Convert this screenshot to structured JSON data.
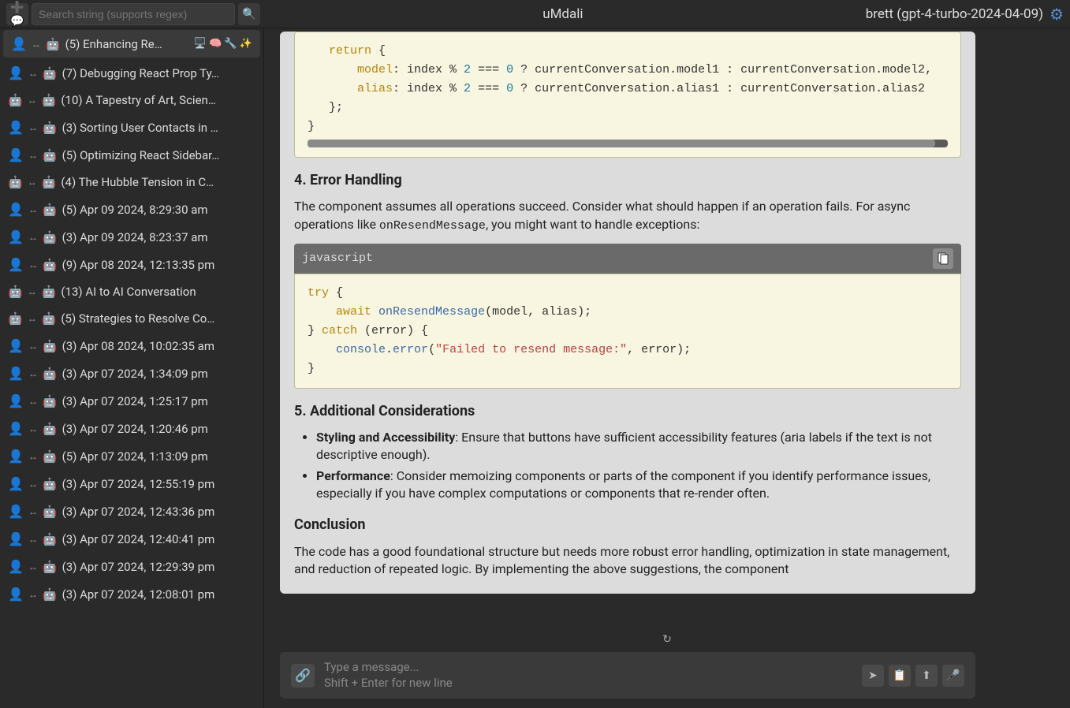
{
  "header": {
    "app_title": "uMdali",
    "user_model": "brett (gpt-4-turbo-2024-04-09)",
    "search_placeholder": "Search string (supports regex)"
  },
  "sidebar": {
    "items": [
      {
        "left_icon": "user",
        "count": 5,
        "title": "Enhancing Re…",
        "extra": "🖥️ 🧠 🔧 ✨",
        "active": true
      },
      {
        "left_icon": "user",
        "count": 7,
        "title": "Debugging React Prop Ty…"
      },
      {
        "left_icon": "robot",
        "count": 10,
        "title": "A Tapestry of Art, Scien…"
      },
      {
        "left_icon": "user",
        "count": 3,
        "title": "Sorting User Contacts in …"
      },
      {
        "left_icon": "user",
        "count": 5,
        "title": "Optimizing React Sidebar…"
      },
      {
        "left_icon": "robot",
        "count": 4,
        "title": "The Hubble Tension in C…"
      },
      {
        "left_icon": "user",
        "count": 5,
        "title": "Apr 09 2024, 8:29:30 am"
      },
      {
        "left_icon": "user",
        "count": 3,
        "title": "Apr 09 2024, 8:23:37 am"
      },
      {
        "left_icon": "user",
        "count": 9,
        "title": "Apr 08 2024, 12:13:35 pm"
      },
      {
        "left_icon": "robot",
        "count": 13,
        "title": "AI to AI Conversation"
      },
      {
        "left_icon": "robot",
        "count": 5,
        "title": "Strategies to Resolve Co…"
      },
      {
        "left_icon": "user",
        "count": 3,
        "title": "Apr 08 2024, 10:02:35 am"
      },
      {
        "left_icon": "user",
        "count": 3,
        "title": "Apr 07 2024, 1:34:09 pm"
      },
      {
        "left_icon": "user",
        "count": 3,
        "title": "Apr 07 2024, 1:25:17 pm"
      },
      {
        "left_icon": "user",
        "count": 3,
        "title": "Apr 07 2024, 1:20:46 pm"
      },
      {
        "left_icon": "user",
        "count": 5,
        "title": "Apr 07 2024, 1:13:09 pm"
      },
      {
        "left_icon": "user",
        "count": 3,
        "title": "Apr 07 2024, 12:55:19 pm"
      },
      {
        "left_icon": "user",
        "count": 3,
        "title": "Apr 07 2024, 12:43:36 pm"
      },
      {
        "left_icon": "user",
        "count": 3,
        "title": "Apr 07 2024, 12:40:41 pm"
      },
      {
        "left_icon": "user",
        "count": 3,
        "title": "Apr 07 2024, 12:29:39 pm"
      },
      {
        "left_icon": "user",
        "count": 3,
        "title": "Apr 07 2024, 12:08:01 pm"
      }
    ]
  },
  "message": {
    "section4_title": "4. Error Handling",
    "section4_text_a": "The component assumes all operations succeed. Consider what should happen if an operation fails. For async operations like ",
    "section4_inline": "onResendMessage",
    "section4_text_b": ", you might want to handle exceptions:",
    "code_lang": "javascript",
    "section5_title": "5. Additional Considerations",
    "bullet1_label": "Styling and Accessibility",
    "bullet1_text": ": Ensure that buttons have sufficient accessibility features (aria labels if the text is not descriptive enough).",
    "bullet2_label": "Performance",
    "bullet2_text": ": Consider memoizing components or parts of the component if you identify performance issues, especially if you have complex computations or components that re-render often.",
    "conclusion_title": "Conclusion",
    "conclusion_text": "The code has a good foundational structure but needs more robust error handling, optimization in state management, and reduction of repeated logic. By implementing the above suggestions, the component"
  },
  "code1": {
    "l1_return": "return",
    "l1_brace": " {",
    "l2_model": "model",
    "l2_rest_a": ": index % ",
    "l2_2": "2",
    "l2_eq": " === ",
    "l2_0": "0",
    "l2_rest_b": " ? currentConversation.model1 : currentConversation.model2,",
    "l3_alias": "alias",
    "l3_rest_a": ": index % ",
    "l3_2": "2",
    "l3_eq": " === ",
    "l3_0": "0",
    "l3_rest_b": " ? currentConversation.alias1 : currentConversation.alias2",
    "l4": "};",
    "l5": "}"
  },
  "code2": {
    "l1_try": "try",
    "l1_brace": " {",
    "l2_await": "await",
    "l2_sp": " ",
    "l2_fn": "onResendMessage",
    "l2_args": "(model, alias);",
    "l3_close": "} ",
    "l3_catch": "catch",
    "l3_rest": " (error) {",
    "l4_console": "console",
    "l4_dot": ".",
    "l4_error": "error",
    "l4_open": "(",
    "l4_str": "\"Failed to resend message:\"",
    "l4_rest": ", error);",
    "l5": "}"
  },
  "input": {
    "placeholder_line1": "Type a message...",
    "placeholder_line2": "Shift + Enter for new line"
  }
}
